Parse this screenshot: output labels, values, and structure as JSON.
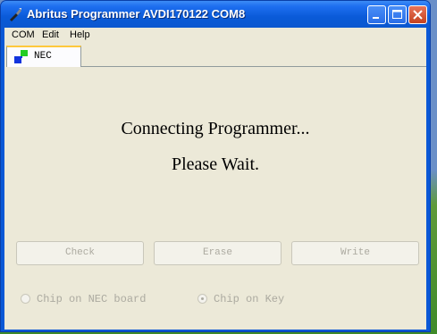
{
  "window": {
    "title": "Abritus Programmer AVDI170122 COM8",
    "controls": [
      "minimize-icon",
      "maximize-icon",
      "close-icon"
    ]
  },
  "menu": {
    "items": [
      {
        "label": "COM"
      },
      {
        "label": "Edit"
      },
      {
        "label": "Help"
      }
    ]
  },
  "tabs": [
    {
      "label": "NEC",
      "icon": "nec-chip-icon",
      "selected": true
    }
  ],
  "status": {
    "line1": "Connecting Programmer...",
    "line2": "Please Wait."
  },
  "buttons": {
    "check": "Check",
    "erase": "Erase",
    "write": "Write"
  },
  "options": {
    "chip_on_nec_board": {
      "label": "Chip on NEC board",
      "selected": false
    },
    "chip_on_key": {
      "label": "Chip on Key",
      "selected": true
    }
  },
  "colors": {
    "titlebar": "#0a5ad8",
    "client_bg": "#ece9d8",
    "disabled_text": "#acaaa0",
    "tab_highlight": "#ffc83c"
  }
}
